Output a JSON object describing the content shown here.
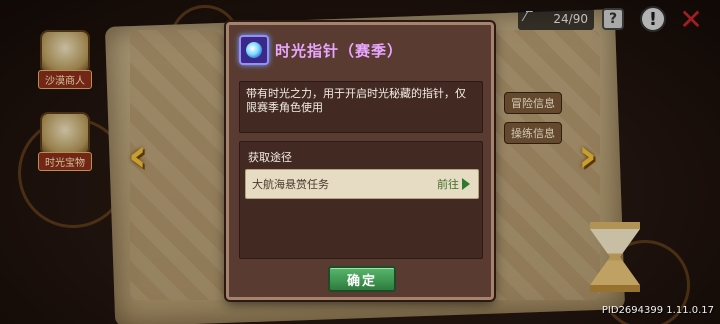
{
  "hud": {
    "counter": "24/90",
    "help_glyph": "?",
    "alert_glyph": "!",
    "close_glyph": "✕"
  },
  "background": {
    "left_icon_top_label": "沙漠商人",
    "left_icon_bottom_label": "时光宝物",
    "map_button_1": "冒险信息",
    "map_button_2": "操练信息"
  },
  "dialog": {
    "title": "时光指针（赛季）",
    "description": "带有时光之力，用于开启时光秘藏的指针，仅限赛季角色使用",
    "source_title": "获取途径",
    "source_label": "大航海悬赏任务",
    "goto_label": "前往",
    "confirm_label": "确定"
  },
  "footer": {
    "pid": "PID2694399 1.11.0.17"
  },
  "icons": {
    "item": "time-pointer-icon",
    "arrow_left": "chevron-left-icon",
    "arrow_right": "chevron-right-icon"
  },
  "colors": {
    "title": "#e9a6ff",
    "confirm_button": "#3e9550",
    "dialog_bg": "#5a3b32",
    "close_icon": "#c0282d"
  }
}
